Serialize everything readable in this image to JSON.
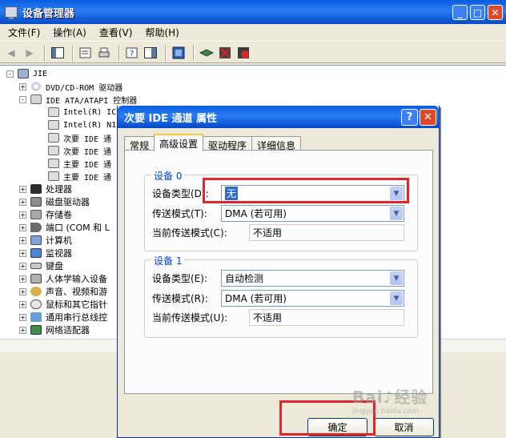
{
  "window": {
    "title": "设备管理器",
    "menu": [
      "文件(F)",
      "操作(A)",
      "查看(V)",
      "帮助(H)"
    ]
  },
  "tree": {
    "root": "JIE",
    "items": [
      {
        "label": "DVD/CD-ROM 驱动器",
        "expander": "+"
      },
      {
        "label": "IDE ATA/ATAPI 控制器",
        "expander": "-"
      },
      {
        "label": "Intel(R) IC",
        "child": true
      },
      {
        "label": "Intel(R) N1",
        "child": true
      },
      {
        "label": "次要 IDE 通",
        "child": true
      },
      {
        "label": "次要 IDE 通",
        "child": true
      },
      {
        "label": "主要 IDE 通",
        "child": true
      },
      {
        "label": "主要 IDE 通",
        "child": true
      },
      {
        "label": "处理器",
        "expander": "+"
      },
      {
        "label": "磁盘驱动器",
        "expander": "+"
      },
      {
        "label": "存储卷",
        "expander": "+"
      },
      {
        "label": "端口 (COM 和 L",
        "expander": "+"
      },
      {
        "label": "计算机",
        "expander": "+"
      },
      {
        "label": "监视器",
        "expander": "+"
      },
      {
        "label": "键盘",
        "expander": "+"
      },
      {
        "label": "人体学输入设备",
        "expander": "+"
      },
      {
        "label": "声音、视频和游",
        "expander": "+"
      },
      {
        "label": "鼠标和其它指针",
        "expander": "+"
      },
      {
        "label": "通用串行总线控",
        "expander": "+"
      },
      {
        "label": "网络适配器",
        "expander": "+"
      }
    ]
  },
  "dialog": {
    "title": "次要 IDE 通道 属性",
    "tabs": [
      "常规",
      "高级设置",
      "驱动程序",
      "详细信息"
    ],
    "active_tab": "高级设置",
    "device0": {
      "title": "设备 0",
      "type_label": "设备类型(D):",
      "type_value": "无",
      "transfer_label": "传送模式(T):",
      "transfer_value": "DMA (若可用)",
      "current_label": "当前传送模式(C):",
      "current_value": "不适用"
    },
    "device1": {
      "title": "设备 1",
      "type_label": "设备类型(E):",
      "type_value": "自动检测",
      "transfer_label": "传送模式(R):",
      "transfer_value": "DMA (若可用)",
      "current_label": "当前传送模式(U):",
      "current_value": "不适用"
    },
    "ok_label": "确定",
    "cancel_label": "取消"
  },
  "colors": {
    "titlebar": "#0a5de0",
    "highlight": "#e0262a",
    "selection": "#316ac5"
  }
}
